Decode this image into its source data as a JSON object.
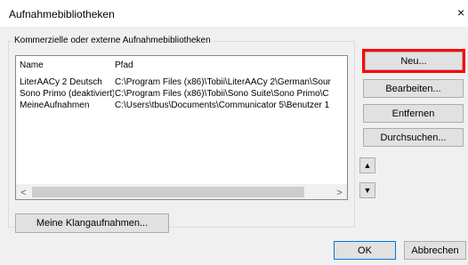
{
  "window": {
    "title": "Aufnahmebibliotheken",
    "close_glyph": "×"
  },
  "group": {
    "label": "Kommerzielle oder externe Aufnahmebibliotheken"
  },
  "list": {
    "columns": [
      "Name",
      "Pfad"
    ],
    "rows": [
      {
        "name": "LiterAACy 2 Deutsch",
        "path": "C:\\Program Files (x86)\\Tobii\\LiterAACy 2\\German\\Sour"
      },
      {
        "name": "Sono Primo (deaktiviert)",
        "path": "C:\\Program Files (x86)\\Tobii\\Sono Suite\\Sono Primo\\C"
      },
      {
        "name": "MeineAufnahmen",
        "path": "C:\\Users\\tbus\\Documents\\Communicator 5\\Benutzer 1"
      }
    ],
    "scroll_left_icon": "chevron-left-icon",
    "scroll_right_icon": "chevron-right-icon"
  },
  "buttons": {
    "new": "Neu...",
    "edit": "Bearbeiten...",
    "remove": "Entfernen",
    "browse": "Durchsuchen...",
    "my_sounds": "Meine Klangaufnahmen...",
    "ok": "OK",
    "cancel": "Abbrechen"
  },
  "arrows": {
    "up": "▲",
    "down": "▼",
    "left": "<",
    "right": ">"
  },
  "colors": {
    "highlight": "#ff0000",
    "dialog_bg": "#f0f0f0",
    "button_bg": "#e1e1e1",
    "default_button_border": "#0078d7"
  }
}
